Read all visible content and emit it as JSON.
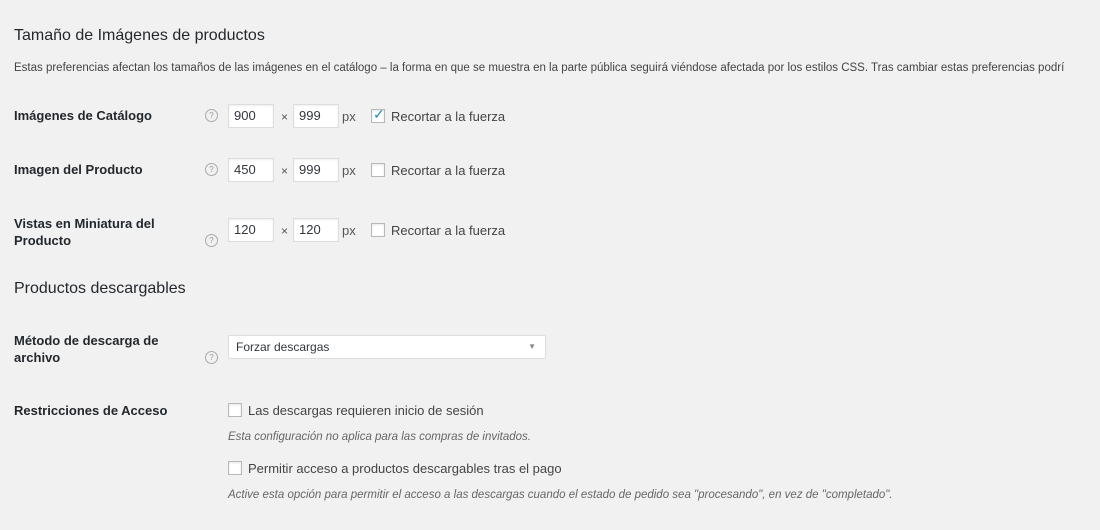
{
  "section1": {
    "title": "Tamaño de Imágenes de productos",
    "description": "Estas preferencias afectan los tamaños de las imágenes en el catálogo – la forma en que se muestra en la parte pública seguirá viéndose afectada por los estilos CSS. Tras cambiar estas preferencias podrí"
  },
  "image_rows": [
    {
      "label_line1": "Imágenes de Catálogo",
      "label_line2": "",
      "width": "900",
      "height": "999",
      "crop_checked": true
    },
    {
      "label_line1": "Imagen del Producto",
      "label_line2": "",
      "width": "450",
      "height": "999",
      "crop_checked": false
    },
    {
      "label_line1": "Vistas en Miniatura del",
      "label_line2": "Producto",
      "width": "120",
      "height": "120",
      "crop_checked": false
    }
  ],
  "common": {
    "times": "×",
    "unit": "px",
    "crop_label": "Recortar a la fuerza",
    "help": "?"
  },
  "section2": {
    "title": "Productos descargables"
  },
  "download_method": {
    "label_line1": "Método de descarga de",
    "label_line2": "archivo",
    "selected": "Forzar descargas",
    "arrow": "▼"
  },
  "access": {
    "label": "Restricciones de Acceso",
    "option1_label": "Las descargas requieren inicio de sesión",
    "option1_checked": false,
    "option1_note": "Esta configuración no aplica para las compras de invitados.",
    "option2_label": "Permitir acceso a productos descargables tras el pago",
    "option2_checked": false,
    "option2_note": "Active esta opción para permitir el acceso a las descargas cuando el estado de pedido sea \"procesando\", en vez de \"completado\"."
  }
}
